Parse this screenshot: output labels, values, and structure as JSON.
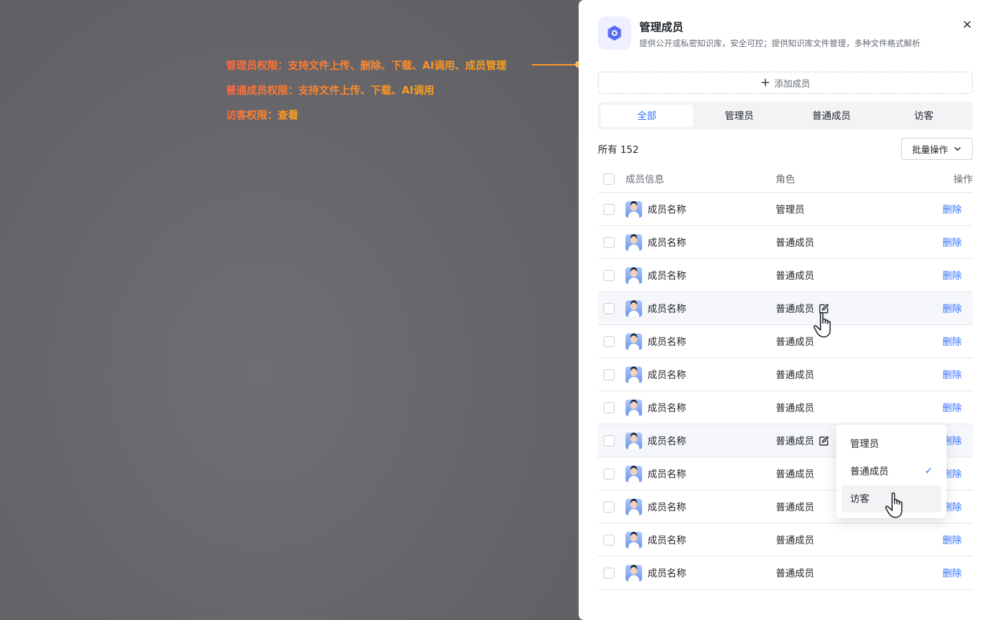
{
  "annotations": [
    "管理员权限：支持文件上传、删除、下载、AI调用、成员管理",
    "普通成员权限：支持文件上传、下载、AI调用",
    "访客权限：查看"
  ],
  "drawer": {
    "title": "管理成员",
    "description": "提供公开或私密知识库，安全可控；提供知识库文件管理，多种文件格式解析",
    "close": "×",
    "add_button": "添加成员",
    "tabs": [
      "全部",
      "管理员",
      "普通成员",
      "访客"
    ],
    "active_tab": 0,
    "count_label": "所有 152",
    "batch_label": "批量操作"
  },
  "table": {
    "headers": {
      "info": "成员信息",
      "role": "角色",
      "op": "操作"
    },
    "rows": [
      {
        "name": "成员名称",
        "role": "管理员",
        "op": "删除"
      },
      {
        "name": "成员名称",
        "role": "普通成员",
        "op": "删除"
      },
      {
        "name": "成员名称",
        "role": "普通成员",
        "op": "删除"
      },
      {
        "name": "成员名称",
        "role": "普通成员",
        "op": "删除"
      },
      {
        "name": "成员名称",
        "role": "普通成员",
        "op": "删除"
      },
      {
        "name": "成员名称",
        "role": "普通成员",
        "op": "删除"
      },
      {
        "name": "成员名称",
        "role": "普通成员",
        "op": "删除"
      },
      {
        "name": "成员名称",
        "role": "普通成员",
        "op": "删除"
      },
      {
        "name": "成员名称",
        "role": "普通成员",
        "op": "删除"
      },
      {
        "name": "成员名称",
        "role": "普通成员",
        "op": "删除"
      },
      {
        "name": "成员名称",
        "role": "普通成员",
        "op": "删除"
      },
      {
        "name": "成员名称",
        "role": "普通成员",
        "op": "删除"
      }
    ]
  },
  "role_dropdown": {
    "options": [
      "管理员",
      "普通成员",
      "访客"
    ],
    "selected": "普通成员"
  },
  "colors": {
    "accent": "#3370ff",
    "annotation": "#ff8a2a"
  }
}
